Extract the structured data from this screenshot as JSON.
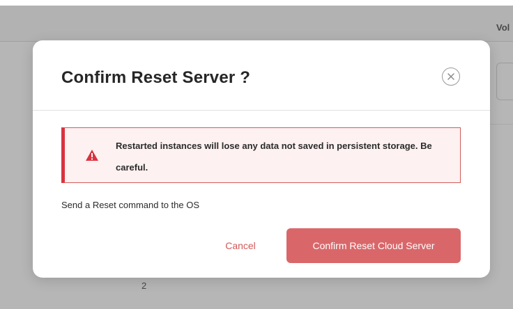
{
  "background": {
    "column_label": "Vol",
    "page_number": "2"
  },
  "modal": {
    "title": "Confirm Reset Server ?",
    "close_icon": "circle-x-icon",
    "alert": {
      "icon": "warning-triangle-icon",
      "text": "Restarted instances will lose any data not saved in persistent storage. Be careful.",
      "color": "#d9333f"
    },
    "description": "Send a Reset command to the OS",
    "cancel_label": "Cancel",
    "confirm_label": "Confirm Reset Cloud Server",
    "confirm_color": "#d9676a"
  }
}
